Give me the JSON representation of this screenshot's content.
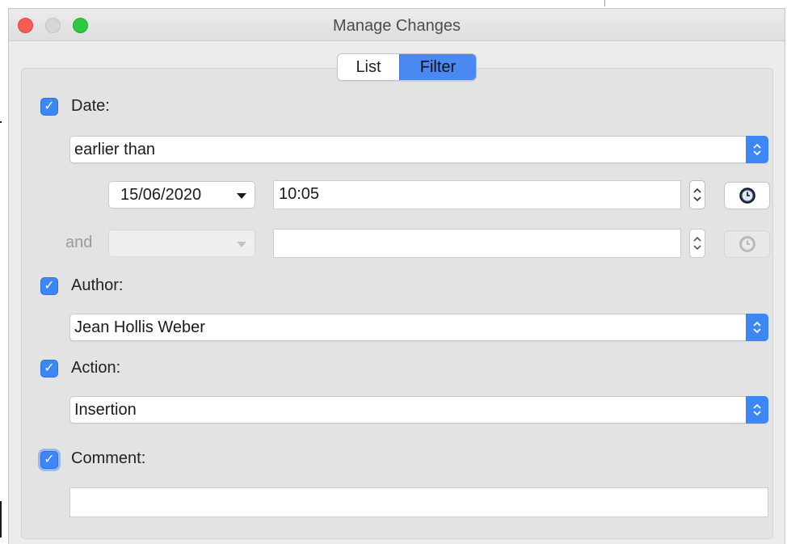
{
  "window": {
    "title": "Manage Changes"
  },
  "tabs": [
    {
      "label": "List",
      "selected": false
    },
    {
      "label": "Filter",
      "selected": true
    }
  ],
  "filter": {
    "date": {
      "label": "Date:",
      "checked": true,
      "condition": "earlier than",
      "date_value": "15/06/2020",
      "time_value": "10:05",
      "and_label": "and",
      "and_date_value": "",
      "and_time_value": ""
    },
    "author": {
      "label": "Author:",
      "checked": true,
      "value": "Jean Hollis Weber"
    },
    "action": {
      "label": "Action:",
      "checked": true,
      "value": "Insertion"
    },
    "comment": {
      "label": "Comment:",
      "checked": true,
      "value": ""
    }
  },
  "colors": {
    "accent": "#3d86f5",
    "selected_tab": "#4a88f2",
    "window_bg": "#ececec",
    "panel_bg": "#e3e3e3"
  },
  "icons": {
    "close": "close-traffic-light",
    "minimize": "minimize-traffic-light",
    "maximize": "maximize-traffic-light",
    "checkbox": "checkmark-icon",
    "stepper": "chevron-up-down-icon",
    "dropdown": "triangle-down-icon",
    "clock": "clock-icon"
  }
}
